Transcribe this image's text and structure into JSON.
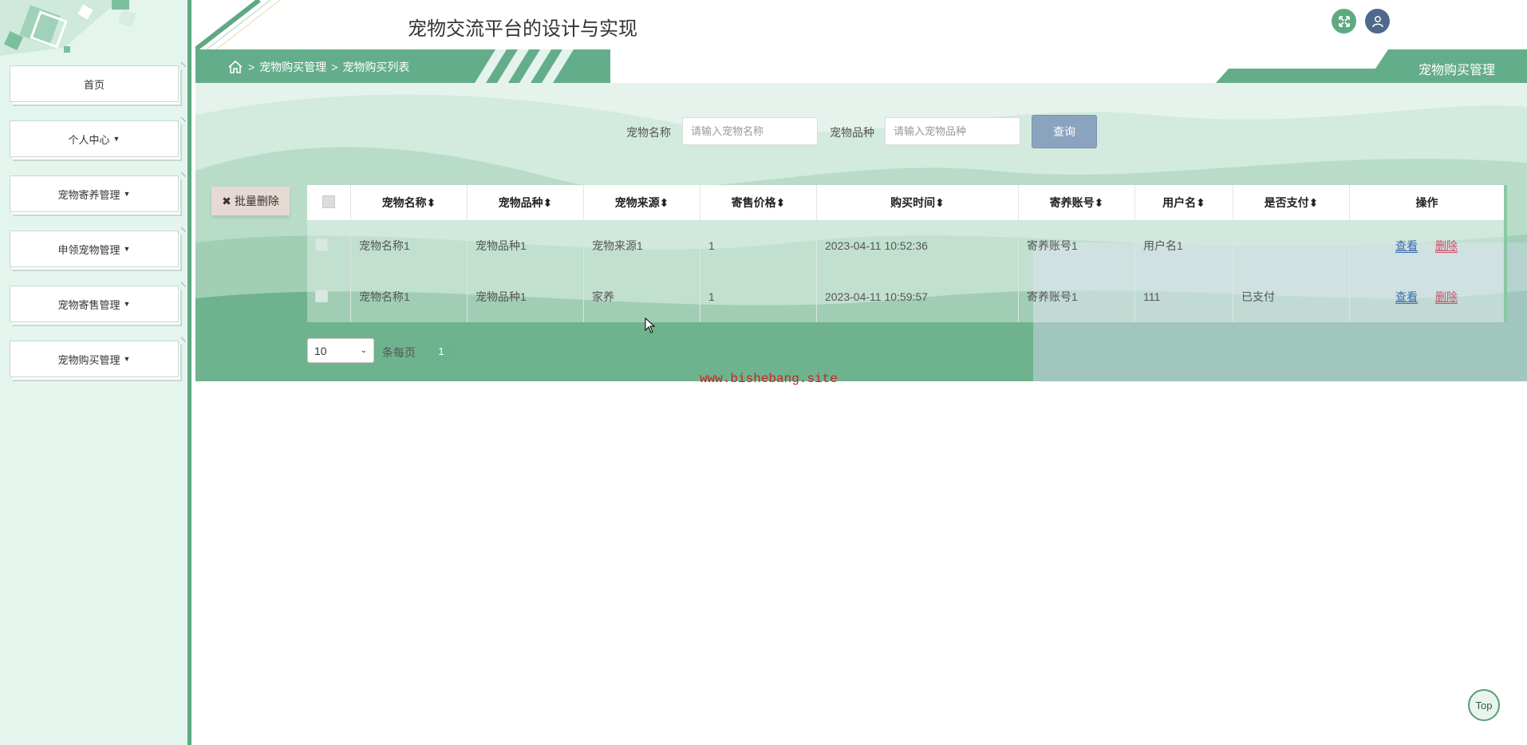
{
  "app": {
    "title": "宠物交流平台的设计与实现",
    "watermark": "www.bishebang.site"
  },
  "colors": {
    "accent_green": "#64ad8a",
    "sidebar_bg": "#e4f5ee",
    "search_button": "#8aa3bf",
    "delete_link": "#d14d6a",
    "view_link": "#3a6fb0",
    "watermark": "#cc2222"
  },
  "header": {
    "fullscreen_icon": "expand-icon",
    "user_icon": "user-icon"
  },
  "sidebar": {
    "items": [
      {
        "label": "首页",
        "has_caret": false
      },
      {
        "label": "个人中心",
        "has_caret": true
      },
      {
        "label": "宠物寄养管理",
        "has_caret": true
      },
      {
        "label": "申领宠物管理",
        "has_caret": true
      },
      {
        "label": "宠物寄售管理",
        "has_caret": true
      },
      {
        "label": "宠物购买管理",
        "has_caret": true
      }
    ]
  },
  "breadcrumb": {
    "home_icon": "home-icon",
    "separator": ">",
    "items": [
      "宠物购买管理",
      "宠物购买列表"
    ]
  },
  "page_tag": "宠物购买管理",
  "search": {
    "name_label": "宠物名称",
    "name_placeholder": "请输入宠物名称",
    "breed_label": "宠物品种",
    "breed_placeholder": "请输入宠物品种",
    "query_button": "查询"
  },
  "batch_delete": {
    "icon": "✖",
    "label": "批量删除"
  },
  "table": {
    "columns": [
      "宠物名称",
      "宠物品种",
      "宠物来源",
      "寄售价格",
      "购买时间",
      "寄养账号",
      "用户名",
      "是否支付",
      "操作"
    ],
    "sort_icon": "⬍",
    "rows": [
      {
        "name": "宠物名称1",
        "breed": "宠物品种1",
        "source": "宠物来源1",
        "price": "1",
        "time": "2023-04-11 10:52:36",
        "account": "寄养账号1",
        "username": "用户名1",
        "paid": ""
      },
      {
        "name": "宠物名称1",
        "breed": "宠物品种1",
        "source": "家养",
        "price": "1",
        "time": "2023-04-11 10:59:57",
        "account": "寄养账号1",
        "username": "111",
        "paid": "已支付"
      }
    ],
    "view_label": "查看",
    "delete_label": "删除"
  },
  "pager": {
    "page_size": "10",
    "per_page_text": "条每页",
    "current_page": "1"
  },
  "top_button": "Top"
}
